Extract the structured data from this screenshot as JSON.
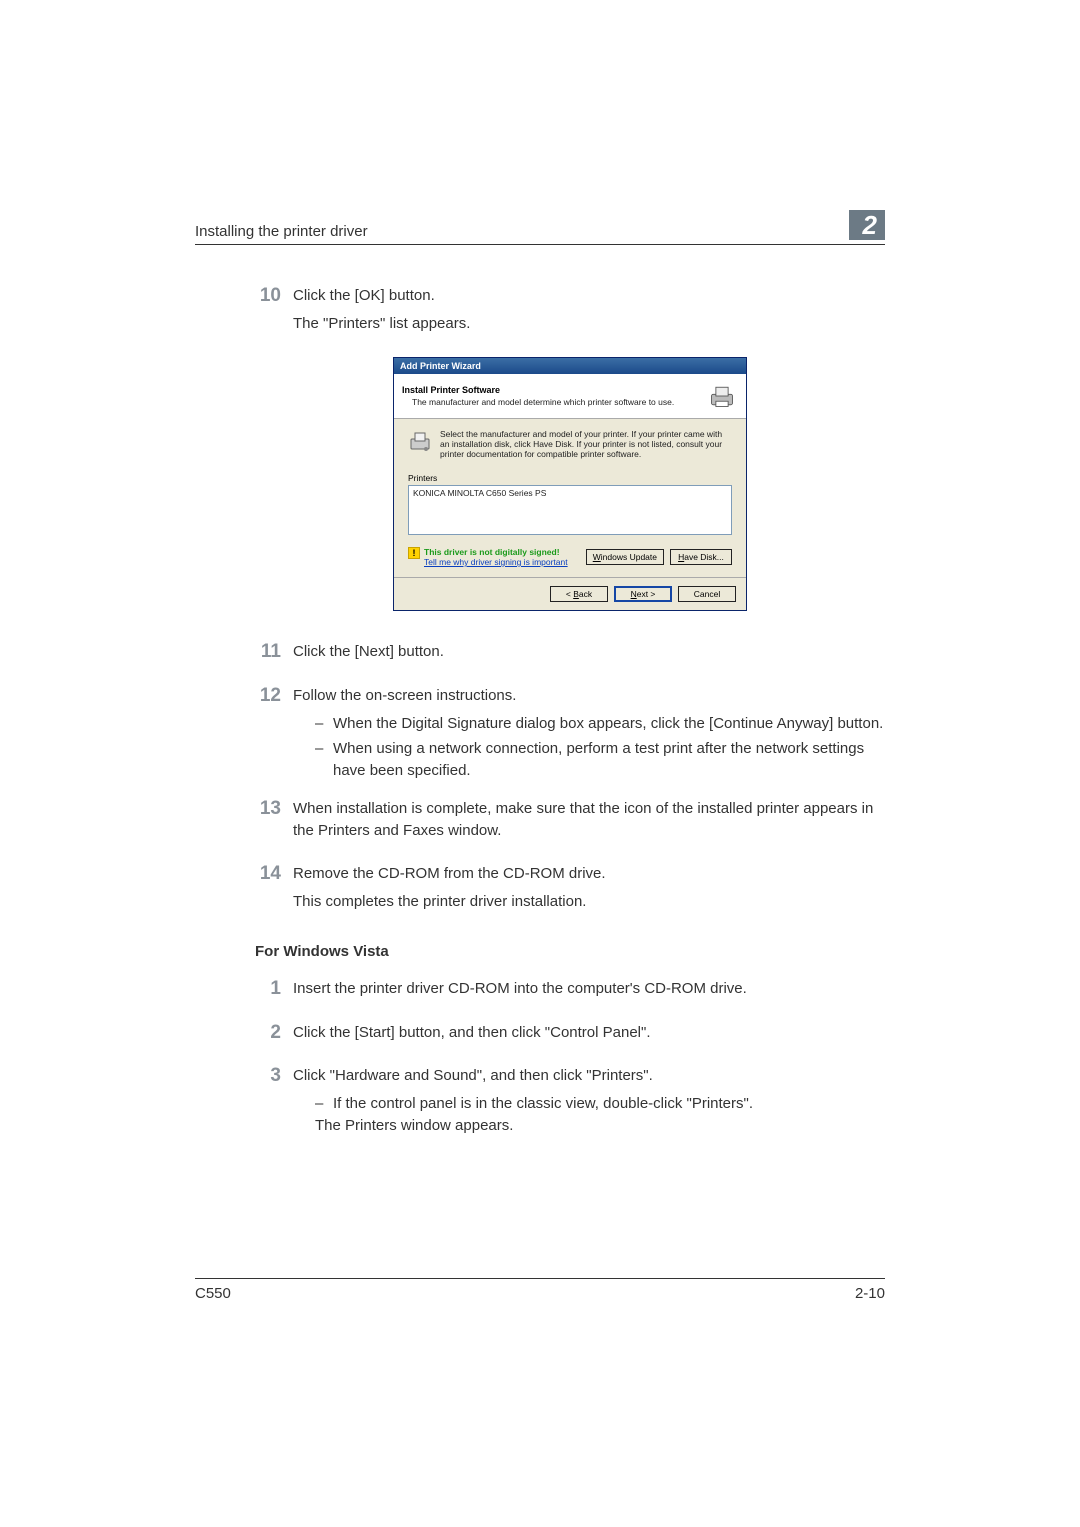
{
  "header": {
    "title": "Installing the printer driver",
    "chapter": "2"
  },
  "steps_a": [
    {
      "num": "10",
      "lines": [
        "Click the [OK] button.",
        "The \"Printers\" list appears."
      ]
    }
  ],
  "wizard": {
    "titlebar": "Add Printer Wizard",
    "head_title": "Install Printer Software",
    "head_desc": "The manufacturer and model determine which printer software to use.",
    "instr": "Select the manufacturer and model of your printer. If your printer came with an installation disk, click Have Disk. If your printer is not listed, consult your printer documentation for compatible printer software.",
    "printers_label": "Printers",
    "printer_item": "KONICA MINOLTA C650 Series PS",
    "sign_line1": "This driver is not digitally signed!",
    "sign_line2": "Tell me why driver signing is important",
    "btn_windows_update": {
      "u": "W",
      "rest": "indows Update"
    },
    "btn_have_disk": {
      "u": "H",
      "rest": "ave Disk..."
    },
    "btn_back": {
      "pre": "< ",
      "u": "B",
      "rest": "ack"
    },
    "btn_next": {
      "u": "N",
      "rest": "ext >"
    },
    "btn_cancel": "Cancel"
  },
  "steps_b": [
    {
      "num": "11",
      "lines": [
        "Click the [Next] button."
      ]
    },
    {
      "num": "12",
      "lines": [
        "Follow the on-screen instructions."
      ],
      "subs": [
        "When the Digital Signature dialog box appears, click the [Continue Anyway] button.",
        "When using a network connection, perform a test print after the network settings have been specified."
      ]
    },
    {
      "num": "13",
      "lines": [
        "When installation is complete, make sure that the icon of the installed printer appears in the Printers and Faxes window."
      ]
    },
    {
      "num": "14",
      "lines": [
        "Remove the CD-ROM from the CD-ROM drive.",
        "This completes the printer driver installation."
      ]
    }
  ],
  "section_heading": "For Windows Vista",
  "steps_c": [
    {
      "num": "1",
      "lines": [
        "Insert the printer driver CD-ROM into the computer's CD-ROM drive."
      ]
    },
    {
      "num": "2",
      "lines": [
        "Click the [Start] button, and then click \"Control Panel\"."
      ]
    },
    {
      "num": "3",
      "lines": [
        "Click \"Hardware and Sound\", and then click \"Printers\"."
      ],
      "subs": [
        "If the control panel is in the classic view, double-click \"Printers\"."
      ],
      "trailing": [
        "The Printers window appears."
      ]
    }
  ],
  "footer": {
    "left": "C550",
    "right": "2-10"
  }
}
